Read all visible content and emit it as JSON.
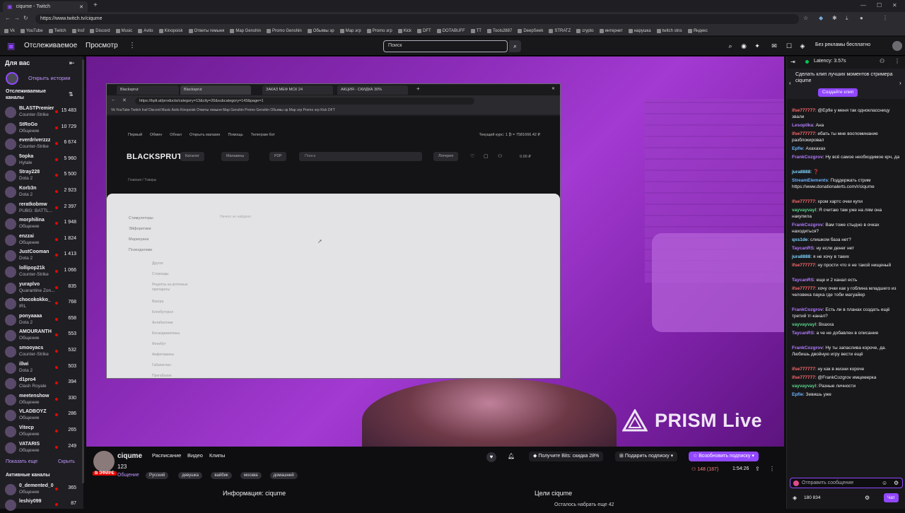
{
  "browser": {
    "tab_title": "ciqume - Twitch",
    "url": "https://www.twitch.tv/ciqume",
    "bookmarks": [
      "Vk",
      "YouTube",
      "Twitch",
      "Insf",
      "Discord",
      "Music",
      "Avito",
      "Kinopoisk",
      "Ответы гемыня",
      "Map Genshin",
      "Promo Genshin",
      "Обьявы эр",
      "Мар эгр",
      "Promo эгр",
      "Kick",
      "DFT",
      "DOTABUFF",
      "TT",
      "Tools2887",
      "DeepSeek",
      "STRATZ",
      "crypto",
      "интернет",
      "нарушка",
      "twitch stns",
      "Яндекс"
    ]
  },
  "topbar": {
    "following": "Отслеживаемое",
    "browse": "Просмотр",
    "more_icon": "⋮",
    "search_placeholder": "Поиск",
    "no_ads": "Без рекламы бесплатно"
  },
  "sidebar": {
    "title": "Для вас",
    "open_history": "Открыть истории",
    "followed_heading": "Отслеживаемые каналы",
    "channels": [
      {
        "name": "BLASTPremier",
        "game": "Counter-Strike",
        "viewers": "15 483"
      },
      {
        "name": "StRoGo",
        "game": "Общение",
        "viewers": "10 729"
      },
      {
        "name": "everdriverzzz",
        "game": "Counter-Strike",
        "viewers": "6 674"
      },
      {
        "name": "5opka",
        "game": "Hytale",
        "viewers": "5 960"
      },
      {
        "name": "Stray228",
        "game": "Dota 2",
        "viewers": "5 500"
      },
      {
        "name": "Korb3n",
        "game": "Dota 2",
        "viewers": "2 923"
      },
      {
        "name": "reratkobmw",
        "game": "PUBG: BATTL...",
        "viewers": "2 397"
      },
      {
        "name": "morphilina",
        "game": "Общение",
        "viewers": "1 948"
      },
      {
        "name": "enzzai",
        "game": "Общение",
        "viewers": "1 824"
      },
      {
        "name": "JustCooman",
        "game": "Dota 2",
        "viewers": "1 413"
      },
      {
        "name": "lollipop21k",
        "game": "Counter-Strike",
        "viewers": "1 066"
      },
      {
        "name": "yuraplvo",
        "game": "Quarantine Zon...",
        "viewers": "835"
      },
      {
        "name": "chocokokko_",
        "game": "IRL",
        "viewers": "768"
      },
      {
        "name": "ponyaaaa",
        "game": "Dota 2",
        "viewers": "658"
      },
      {
        "name": "AMOURANTH",
        "game": "Общение",
        "viewers": "553"
      },
      {
        "name": "smooyacs",
        "game": "Counter-Strike",
        "viewers": "532"
      },
      {
        "name": "illwi",
        "game": "Dota 2",
        "viewers": "503"
      },
      {
        "name": "d1pro4",
        "game": "Clash Royale",
        "viewers": "394"
      },
      {
        "name": "meetenshow",
        "game": "Общение",
        "viewers": "330"
      },
      {
        "name": "VLADBOYZ",
        "game": "Общение",
        "viewers": "286"
      },
      {
        "name": "Vitecp",
        "game": "Общение",
        "viewers": "265"
      },
      {
        "name": "VATARIS",
        "game": "Общение",
        "viewers": "249"
      }
    ],
    "show_more": "Показать еще",
    "hide": "Скрыть",
    "active_heading": "Активные каналы",
    "active_channels": [
      {
        "name": "0_demented_0",
        "game": "Общение",
        "viewers": "365"
      },
      {
        "name": "leshiy099",
        "game": "",
        "viewers": "87"
      }
    ]
  },
  "inner_browser": {
    "tab1": "Blacksprut",
    "tab2": "Blacksprut",
    "tab3": "ЗАКАЗ МЕФ МСК 24",
    "tab4": "АКЦИЯ - СКИДКА 30%",
    "url": "https://bplt.at/products/category=13&city=26&subcategory=143&page=1",
    "bookmarks_line": "Vk  YouTube  Twitch  Insf  Discord  Music  Avito  Kinopoisk  Ответы гемыня  Map Genshin  Promo Genshin  Обьявы эр  Мар эгр  Promo эгр  Kick  DFT",
    "nav": [
      "Первый",
      "Обмен",
      "Обнал",
      "Открыть магазин",
      "Помощь",
      "Телеграм бот"
    ],
    "rate": "Текущий курс: 1 ₿ = 7581666.42 ₽",
    "logo": "BLACKSPRUT",
    "catalog": "Каталог",
    "shops": "Магазины",
    "p2p": "P2P",
    "search": "Поиск",
    "lottery": "Лотерея",
    "balance": "0.00 ₽",
    "breadcrumb": "Главная / Товары",
    "categories": [
      "Стимуляторы",
      "Эйфоретики",
      "Марихуана",
      "Психоделики"
    ],
    "subcategories": [
      "Другое",
      "Стероиды",
      "Рецепты на аптечные препараты",
      "Виагра",
      "Кленбутерол",
      "Антибиотики",
      "Бензодиазепины",
      "Фенибут",
      "Амфетамины",
      "Габапентин",
      "Прегабалин"
    ],
    "no_results": "Ничего не найдено"
  },
  "player": {
    "watermark": "PRISM Live"
  },
  "stream": {
    "streamer": "ciqume",
    "title": "123",
    "live_badge": "В ЭФИРЕ",
    "links": [
      "Расписание",
      "Видео",
      "Клипы"
    ],
    "category": "Общение",
    "tags": [
      "Русский",
      "девушка",
      "вайбик",
      "москва",
      "домашний"
    ],
    "bits_button": "Получите Bits: скидка 28%",
    "gift_button": "Подарить подписку",
    "resub_button": "Возобновить подписку",
    "viewers": "148 (187)",
    "uptime": "1:54:26",
    "info_title": "Информация: ciqume",
    "goals_title": "Цели ciqume",
    "goal_text": "Осталось набрать еще 42"
  },
  "chat": {
    "latency": "Latency: 3.57s",
    "clip_prompt": "Сделать клип лучших моментов стримера ciqume",
    "clip_button": "Создайте клип",
    "messages": [
      {
        "user": "ifse777777",
        "color": "#ff6b6b",
        "text": "@Epfie у меня так одноклассницу звали"
      },
      {
        "user": "Lesopilka",
        "color": "#b57cff",
        "text": "Ана"
      },
      {
        "user": "ifse777777",
        "color": "#ff6b6b",
        "text": "ебать ты мне воспоминание разблокировал"
      },
      {
        "user": "Epfie",
        "color": "#6cb4ff",
        "text": "Ахахахах"
      },
      {
        "user": "FrankCozgrov",
        "color": "#b57cff",
        "text": "Ну всё самое необходимое крч, да"
      },
      {
        "user": "jura8888",
        "color": "#7fd4ff",
        "text": "❓"
      },
      {
        "user": "StreamElements",
        "color": "#6cb4ff",
        "text": "Поддержать стрим https://www.donationalerts.com/r/ciqume"
      },
      {
        "user": "ifse777777",
        "color": "#ff6b6b",
        "text": "хром хартс очки купи"
      },
      {
        "user": "vayvayvayl",
        "color": "#59d98a",
        "text": "Я считаю там уже на лям она накупила"
      },
      {
        "user": "FrankCozgrov",
        "color": "#b57cff",
        "text": "Вам тоже стыдно в очках находиться?"
      },
      {
        "user": "qxs1de",
        "color": "#7fd4ff",
        "text": "слишком база нет?"
      },
      {
        "user": "TaycanRS",
        "color": "#b57cff",
        "text": "ну если денег нет"
      },
      {
        "user": "jura8888",
        "color": "#7fd4ff",
        "text": "я не хочу в таких"
      },
      {
        "user": "ifse777777",
        "color": "#ff6b6b",
        "text": "ну прости что я не такой нищеный"
      },
      {
        "user": "TaycanRS",
        "color": "#b57cff",
        "text": "еще и 2 канал есть"
      },
      {
        "user": "ifse777777",
        "color": "#ff6b6b",
        "text": "хочу очки как у гоблина младшего из человека паука где тоби магуайер"
      },
      {
        "user": "FrankCozgrov",
        "color": "#b57cff",
        "text": "Есть ли в планах создать ещё третий тг-канал?"
      },
      {
        "user": "vayvayvayl",
        "color": "#59d98a",
        "text": "Bxaxxa"
      },
      {
        "user": "TaycanRS",
        "color": "#b57cff",
        "text": "а че не добавлен в описание"
      },
      {
        "user": "FrankCozgrov",
        "color": "#b57cff",
        "text": "Ну ты запаслива короче, да. Любишь двойную игру вести ещё"
      },
      {
        "user": "ifse777777",
        "color": "#ff6b6b",
        "text": "ну как в жизни короче"
      },
      {
        "user": "ifse777777",
        "color": "#ff6b6b",
        "text": "@FrankCozgrov имцемерка"
      },
      {
        "user": "vayvayvayl",
        "color": "#59d98a",
        "text": "Разные личности"
      },
      {
        "user": "Epfie",
        "color": "#6cb4ff",
        "text": "Зевишь уже"
      }
    ],
    "input_placeholder": "Отправить сообщение",
    "points": "180 834",
    "chat_button": "Чат"
  }
}
